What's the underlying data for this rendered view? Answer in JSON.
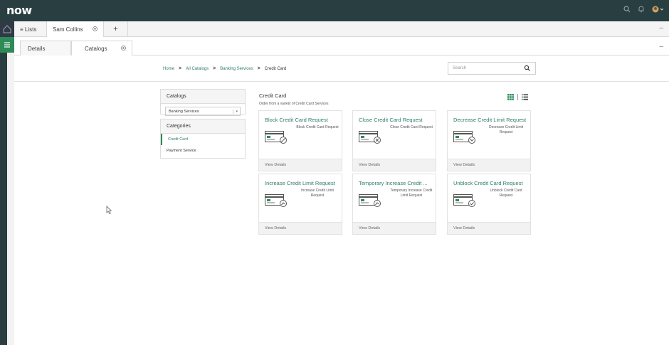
{
  "header": {
    "logo": "now"
  },
  "tabs_top": [
    {
      "label": "≡ Lists"
    },
    {
      "label": "Sam Collins"
    },
    {
      "label": "+"
    }
  ],
  "tabs_sub": [
    {
      "label": "Details"
    },
    {
      "label": "Catalogs"
    }
  ],
  "breadcrumb": {
    "items": [
      "Home",
      "All Catalogs",
      "Banking Services",
      "Credit Card"
    ]
  },
  "search": {
    "placeholder": "Search"
  },
  "catalogs_panel": {
    "heading": "Catalogs",
    "selected": "Banking Services"
  },
  "categories_panel": {
    "heading": "Categories",
    "items": [
      "Credit Card",
      "Payment Service"
    ]
  },
  "main": {
    "title": "Credit Card",
    "subtitle": "Order from a variety of Credit Card Services"
  },
  "cards": [
    {
      "title": "Block Credit Card Request",
      "desc": "Block Credit Card Request",
      "footer": "View Details",
      "icon": "block-card-icon"
    },
    {
      "title": "Close Credit Card Request",
      "desc": "Close Credit Card Request",
      "footer": "View Details",
      "icon": "close-card-icon"
    },
    {
      "title": "Decrease Credit Limit Request",
      "desc": "Decrease Credit Limit Request",
      "footer": "View Details",
      "icon": "decrease-card-icon"
    },
    {
      "title": "Increase Credit Limit Request",
      "desc": "Increase Credit Limit Request",
      "footer": "View Details",
      "icon": "increase-card-icon"
    },
    {
      "title": "Temporary Increase Credit ...",
      "desc": "Temporary Increase Credit Limit Request",
      "footer": "View Details",
      "icon": "temp-increase-card-icon"
    },
    {
      "title": "Unblock Credit Card Request",
      "desc": "Unblock Credit Card Request",
      "footer": "View Details",
      "icon": "unblock-card-icon"
    }
  ],
  "colors": {
    "header_bg": "#293e40",
    "accent_green": "#2e8b57",
    "link": "#2e7d6b"
  }
}
